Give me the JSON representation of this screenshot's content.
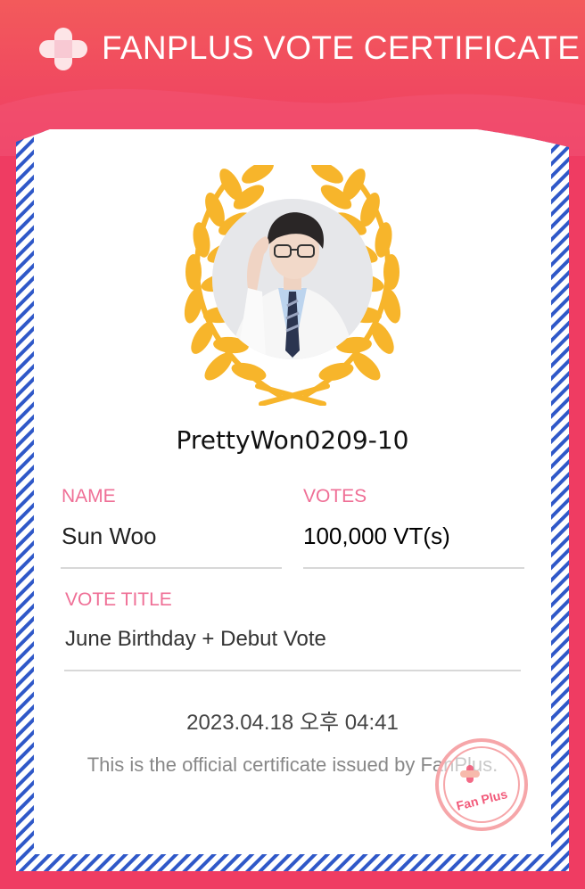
{
  "header": {
    "title": "FANPLUS VOTE CERTIFICATE",
    "logo_icon": "fanplus-cross-logo-icon"
  },
  "certificate": {
    "username": "PrettyWon0209-10",
    "name_label": "NAME",
    "name_value": "Sun Woo",
    "votes_label": "VOTES",
    "votes_value": "100,000 VT(s)",
    "vote_title_label": "VOTE TITLE",
    "vote_title_value": "June Birthday + Debut Vote",
    "datetime": "2023.04.18 오후 04:41",
    "footnote": "This is the official certificate issued by FanPlus.",
    "stamp_text": "Fan Plus"
  },
  "colors": {
    "brand_pink": "#ef3c62",
    "label_pink": "#ef6f96",
    "laurel_gold": "#f7b52b",
    "border_blue": "#2f58c8"
  }
}
